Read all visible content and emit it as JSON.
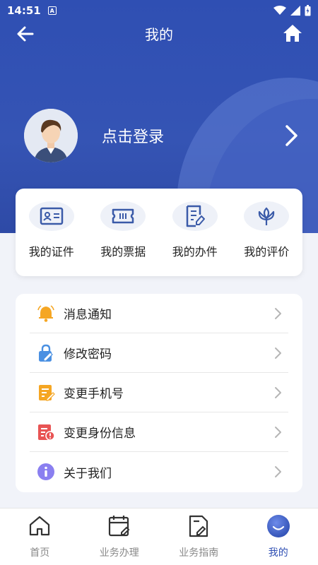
{
  "status_bar": {
    "time": "14:51",
    "notif_glyph": "A"
  },
  "nav": {
    "title": "我的",
    "back_icon": "arrow-left-icon",
    "home_icon": "home-icon"
  },
  "profile": {
    "login_text": "点击登录"
  },
  "quick_items": [
    {
      "label": "我的证件",
      "icon": "id-card-icon"
    },
    {
      "label": "我的票据",
      "icon": "ticket-icon"
    },
    {
      "label": "我的办件",
      "icon": "document-edit-icon"
    },
    {
      "label": "我的评价",
      "icon": "flower-icon"
    }
  ],
  "menu": [
    {
      "label": "消息通知",
      "icon": "bell-icon",
      "color": "#f5a623"
    },
    {
      "label": "修改密码",
      "icon": "lock-edit-icon",
      "color": "#4a90e2"
    },
    {
      "label": "变更手机号",
      "icon": "form-edit-icon",
      "color": "#f5a623"
    },
    {
      "label": "变更身份信息",
      "icon": "id-alert-icon",
      "color": "#e85454"
    },
    {
      "label": "关于我们",
      "icon": "info-icon",
      "color": "#8a7ff0"
    }
  ],
  "tabs": [
    {
      "label": "首页",
      "icon": "home-outline-icon",
      "active": false
    },
    {
      "label": "业务办理",
      "icon": "calendar-edit-icon",
      "active": false
    },
    {
      "label": "业务指南",
      "icon": "guide-doc-icon",
      "active": false
    },
    {
      "label": "我的",
      "icon": "smile-icon",
      "active": true
    }
  ],
  "colors": {
    "primary": "#2f4fb3",
    "background": "#f1f3f9"
  }
}
